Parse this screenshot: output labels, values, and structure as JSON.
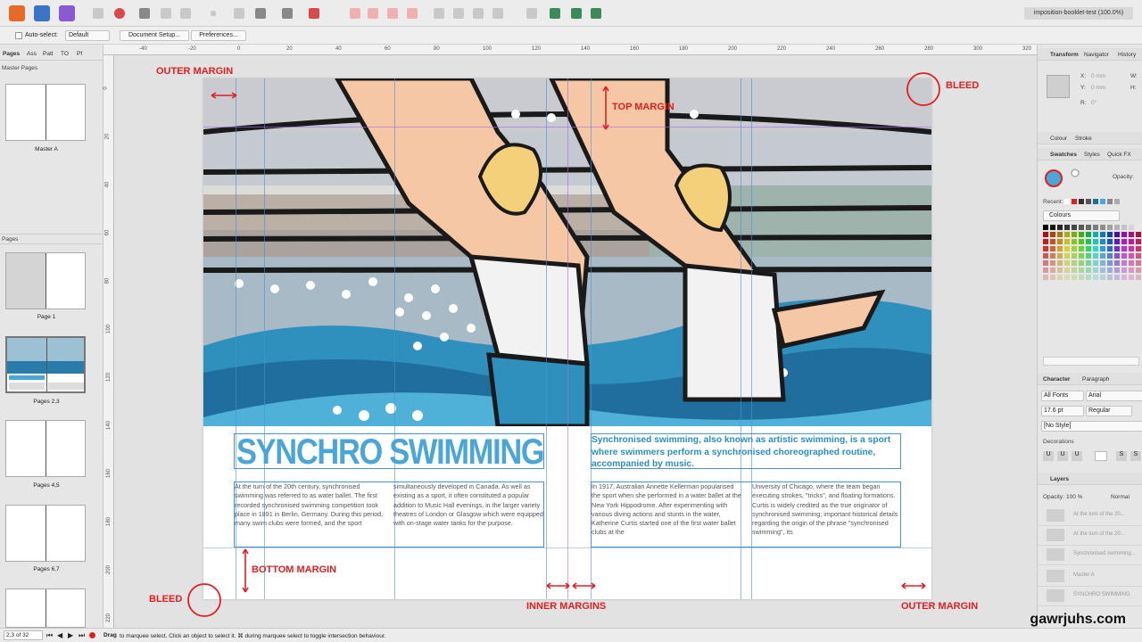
{
  "app": {
    "document_title": "imposition-booklet-test (100.0%)"
  },
  "context_toolbar": {
    "autoselect_label": "Auto-select:",
    "autoselect_value": "Default",
    "document_setup_label": "Document Setup...",
    "preferences_label": "Preferences..."
  },
  "left_panel": {
    "tabs": [
      "Pages",
      "Ass",
      "Patt",
      "TO",
      "Pf"
    ],
    "master_pages_label": "Master Pages",
    "master_label": "Master A",
    "pages_label": "Pages",
    "thumbnails": [
      "Page 1",
      "Pages 2,3",
      "Pages 4,5",
      "Pages 6,7"
    ]
  },
  "ruler": {
    "top": [
      "-40",
      "-20",
      "0",
      "20",
      "40",
      "60",
      "80",
      "100",
      "120",
      "140",
      "160",
      "180",
      "200",
      "220",
      "240",
      "260",
      "280",
      "300",
      "320",
      "340"
    ],
    "left": [
      "0",
      "20",
      "40",
      "60",
      "80",
      "100",
      "120",
      "140",
      "160",
      "180",
      "200",
      "220"
    ]
  },
  "annotations": {
    "outer_margin_top": "OUTER MARGIN",
    "bleed_top": "BLEED",
    "top_margin": "TOP MARGIN",
    "bottom_margin": "BOTTOM MARGIN",
    "bleed_bottom": "BLEED",
    "inner_margins": "INNER MARGINS",
    "outer_margin_bottom": "OUTER MARGIN"
  },
  "article": {
    "title": "SYNCHRO SWIMMING",
    "lead": "Synchronised swimming, also known as artistic swimming, is a sport where swimmers perform a synchronised choreographed routine, accompanied by music.",
    "col1": "At the turn of the 20th century, synchronised swimming was referred to as water ballet. The first recorded synchronised swimming competition took place in 1891 in Berlin, Germany. During this period, many swim clubs were formed, and the sport",
    "col2": "simultaneously developed in Canada. As well as existing as a sport, it often constituted a popular addition to Music Hall evenings, in the larger variety theatres of London or Glasgow which were equipped with on-stage water tanks for the purpose.",
    "col3": "In 1917, Australian Annette Kellerman popularised the sport when she performed in a water ballet at the New York Hippodrome. After experimenting with various diving actions and stunts in the water, Katherine Curtis started one of the first water ballet clubs at the",
    "col4": "University of Chicago, where the team began executing strokes, \"tricks\", and floating formations. Curtis is widely credited as the true originator of synchronised swimming; important historical details regarding the origin of the phrase \"synchronised swimming\", its"
  },
  "right_panel": {
    "transform_tabs": [
      "Transform",
      "Navigator",
      "History"
    ],
    "x_label": "X:",
    "x_value": "0 mm",
    "y_label": "Y:",
    "y_value": "0 mm",
    "w_label": "W:",
    "h_label": "H:",
    "r_label": "R:",
    "r_value": "0°",
    "colour_tabs": [
      "Colour",
      "Stroke"
    ],
    "swatch_tabs": [
      "Swatches",
      "Styles",
      "Quick FX"
    ],
    "opacity_label": "Opacity:",
    "recent_label": "Recent:",
    "palette_name": "Colours",
    "character_tabs": [
      "Character",
      "Paragraph"
    ],
    "font_collection": "All Fonts",
    "font_name": "Arial",
    "font_size": "17.6 pt",
    "font_style": "Regular",
    "text_style": "[No Style]",
    "decorations_label": "Decorations",
    "layers_label": "Layers",
    "layers_opacity_label": "Opacity:",
    "layers_opacity_value": "100 %",
    "blend_mode": "Normal",
    "layers": [
      "At the turn of the 20...",
      "At the turn of the 20...",
      "Synchronised swimming...",
      "Master A",
      "SYNCHRO SWIMMING"
    ]
  },
  "status": {
    "page_indicator": "2,3 of 32",
    "hint_drag": "Drag",
    "hint_text": " to marquee select. Click an object to select it. ⌘ during marquee select to toggle intersection behaviour."
  },
  "watermark": "gawrjuhs.com",
  "colors": {
    "accent_red": "#e02020",
    "title_blue": "#4aa6d8",
    "lead_blue": "#2a8fc2",
    "guide_blue": "#4a8fd8"
  }
}
